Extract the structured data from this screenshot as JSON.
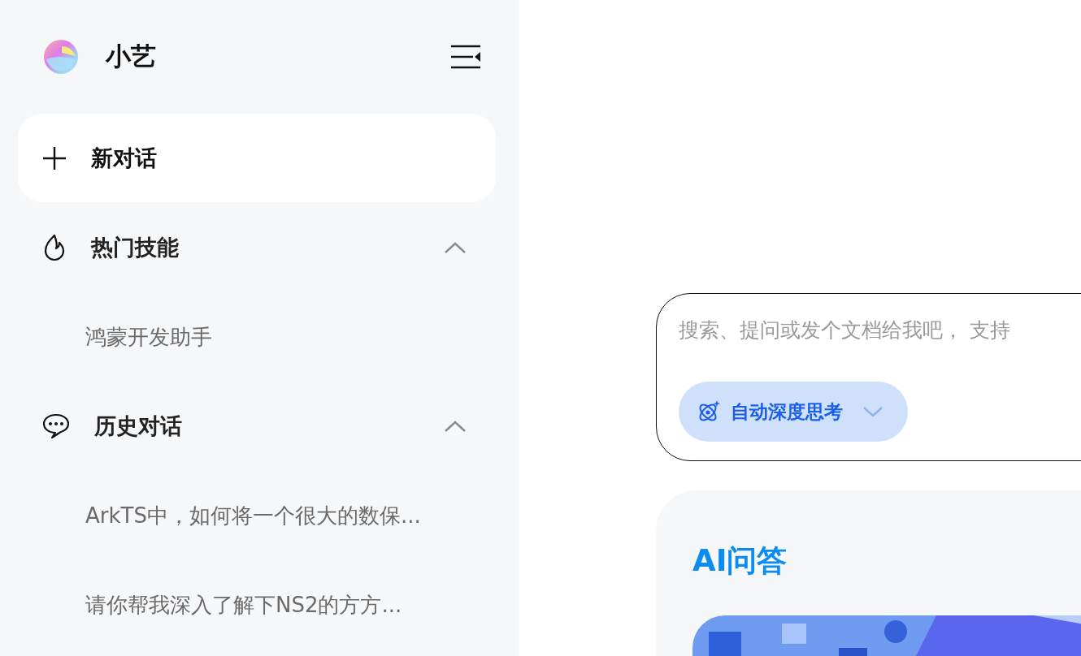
{
  "app": {
    "title": "小艺"
  },
  "new_chat": {
    "label": "新对话"
  },
  "sections": [
    {
      "kind": "skills",
      "title": "热门技能",
      "expanded": true,
      "items": [
        {
          "label": "鸿蒙开发助手"
        }
      ]
    },
    {
      "kind": "history",
      "title": "历史对话",
      "expanded": true,
      "items": [
        {
          "label": "ArkTS中，如何将一个很大的数保..."
        },
        {
          "label": "请你帮我深入了解下NS2的方方..."
        }
      ]
    }
  ],
  "composer": {
    "placeholder": "搜索、提问或发个文档给我吧， 支持",
    "mode": {
      "label": "自动深度思考"
    }
  },
  "card": {
    "title": "AI问答"
  }
}
